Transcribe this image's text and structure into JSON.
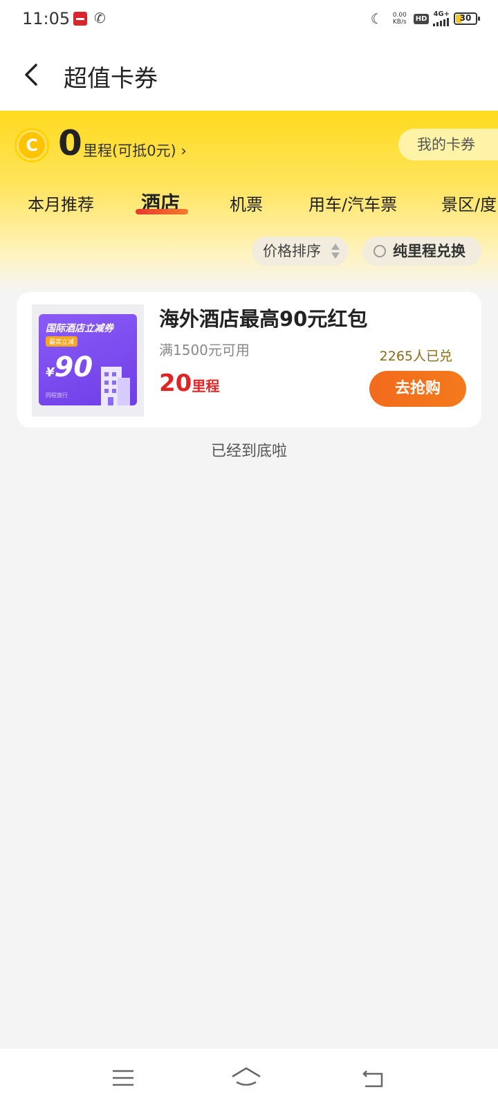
{
  "status_bar": {
    "time": "11:05",
    "net_speed_value": "0.00",
    "net_speed_unit": "KB/s",
    "hd_label": "HD",
    "network_label": "4G+",
    "battery_level": "30"
  },
  "header": {
    "title": "超值卡券"
  },
  "points": {
    "value": "0",
    "label": "里程(可抵0元) ›",
    "my_coupons": "我的卡券"
  },
  "tabs": [
    {
      "label": "本月推荐"
    },
    {
      "label": "酒店"
    },
    {
      "label": "机票"
    },
    {
      "label": "用车/汽车票"
    },
    {
      "label": "景区/度"
    }
  ],
  "filters": {
    "sort_label": "价格排序",
    "points_only_label": "纯里程兑换"
  },
  "product": {
    "title": "海外酒店最高90元红包",
    "condition": "满1500元可用",
    "redeemed": "2265人已兑",
    "price_value": "20",
    "price_unit": "里程",
    "buy_label": "去抢购",
    "thumb": {
      "title": "国际酒店立减券",
      "badge": "最高立减",
      "currency": "¥",
      "amount": "90",
      "brand": "同程旅行"
    }
  },
  "list_end_text": "已经到底啦",
  "colors": {
    "accent_yellow": "#ffda1f",
    "price_red": "#e02424",
    "button_orange": "#f26b1d",
    "coupon_purple": "#7b4cf0"
  }
}
